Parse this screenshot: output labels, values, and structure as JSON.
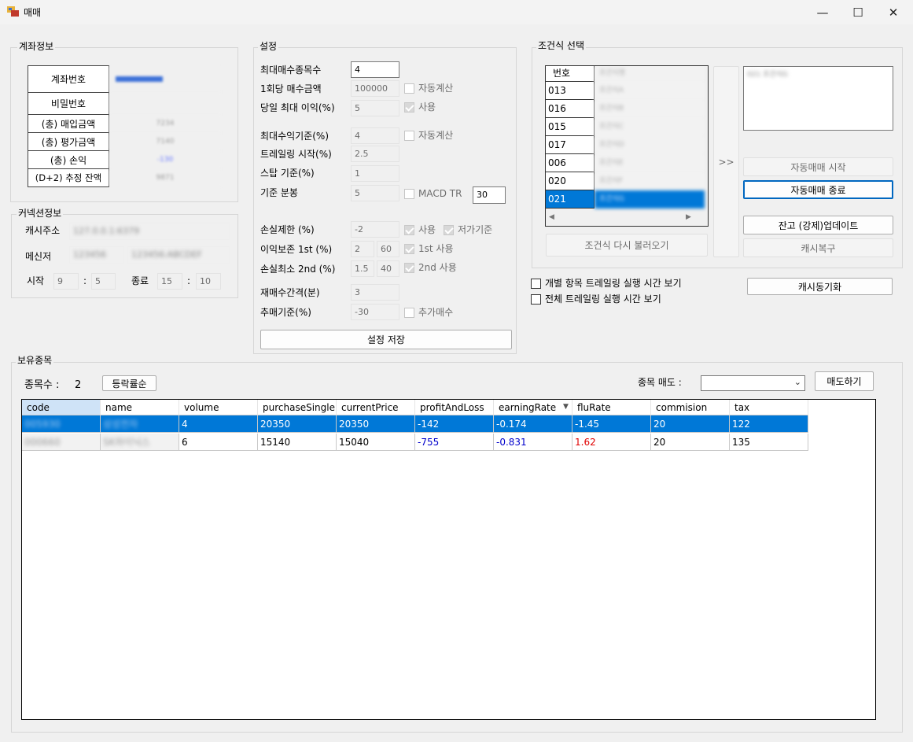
{
  "window": {
    "title": "매매",
    "minimize": "—",
    "maximize": "☐",
    "close": "✕"
  },
  "account": {
    "title": "계좌정보",
    "rows": [
      {
        "label": "계좌번호",
        "value": "■■■■■■"
      },
      {
        "label": "비밀번호",
        "value": ""
      },
      {
        "label": "(총) 매입금액",
        "value": "7234"
      },
      {
        "label": "(총) 평가금액",
        "value": "7140"
      },
      {
        "label": "(총) 손익",
        "value": "-130"
      },
      {
        "label": "(D+2) 추정 잔액",
        "value": "9871"
      }
    ]
  },
  "connection": {
    "title": "커넥션정보",
    "cache_label": "캐시주소",
    "cache_value": "127.0.0.1:6379",
    "messenger_label": "메신저",
    "messenger_value1": "123456 ",
    "messenger_value2": "123456:ABCDEF",
    "start_label": "시작",
    "start_h": "9",
    "start_m": "5",
    "sep": ":",
    "end_label": "종료",
    "end_h": "15",
    "end_m": "10"
  },
  "settings": {
    "title": "설정",
    "max_buy_count_label": "최대매수종목수",
    "max_buy_count": "4",
    "buy_amount_label": "1회당 매수금액",
    "buy_amount": "100000",
    "auto_calc1": "자동계산",
    "daily_max_profit_label": "당일 최대 이익(%)",
    "daily_max_profit": "5",
    "use1": "사용",
    "max_profit_label": "최대수익기준(%)",
    "max_profit": "4",
    "auto_calc2": "자동계산",
    "trailing_start_label": "트레일링 시작(%)",
    "trailing_start": "2.5",
    "stop_label": "스탑 기준(%)",
    "stop": "1",
    "base_minute_label": "기준 분봉",
    "base_minute": "5",
    "macd_label": "MACD TR",
    "macd_value": "30",
    "loss_limit_label": "손실제한 (%)",
    "loss_limit": "-2",
    "use2": "사용",
    "low_base": "저가기준",
    "profit_keep_label": "이익보존 1st (%)",
    "profit_keep_a": "2",
    "profit_keep_b": "60",
    "first_use": "1st 사용",
    "loss_min_label": "손실최소 2nd (%)",
    "loss_min_a": "1.5",
    "loss_min_b": "40",
    "second_use": "2nd 사용",
    "rebuy_interval_label": "재매수간격(분)",
    "rebuy_interval": "3",
    "add_buy_label": "추매기준(%)",
    "add_buy": "-30",
    "add_buy_check": "추가매수",
    "save_button": "설정 저장"
  },
  "condition": {
    "title": "조건식 선택",
    "header": "번호",
    "rows": [
      {
        "no": "013",
        "name": "조건식A"
      },
      {
        "no": "016",
        "name": "조건식B"
      },
      {
        "no": "015",
        "name": "조건식C"
      },
      {
        "no": "017",
        "name": "조건식D"
      },
      {
        "no": "006",
        "name": "조건식E"
      },
      {
        "no": "020",
        "name": "조건식F"
      },
      {
        "no": "021",
        "name": "조건식G"
      }
    ],
    "header_name": "조건식명",
    "reload_button": "조건식 다시 불러오기",
    "move_button": ">>",
    "selected_text": "021 조건식G",
    "auto_start": "자동매매 시작",
    "auto_stop": "자동매매 종료",
    "balance_update": "잔고 (강제)업데이트",
    "cache_restore": "캐시복구",
    "cache_sync": "캐시동기화",
    "view_each": "개별 항목 트레일링 실행 시간 보기",
    "view_all": "전체 트레일링 실행 시간 보기"
  },
  "holdings": {
    "title": "보유종목",
    "count_label": "종목수 :",
    "count": "2",
    "sort_button": "등락률순",
    "sell_label": "종목 매도 :",
    "sell_button": "매도하기",
    "columns": [
      "code",
      "name",
      "volume",
      "purchaseSingle",
      "currentPrice",
      "profitAndLoss",
      "earningRate",
      "fluRate",
      "commision",
      "tax"
    ],
    "rows": [
      {
        "code": "005930",
        "name": "삼성전자",
        "volume": "4",
        "purchaseSingle": "20350",
        "currentPrice": "20350",
        "profitAndLoss": "-142",
        "earningRate": "-0.174",
        "fluRate": "-1.45",
        "commision": "20",
        "tax": "122"
      },
      {
        "code": "000660",
        "name": "SK하이닉스",
        "volume": "6",
        "purchaseSingle": "15140",
        "currentPrice": "15040",
        "profitAndLoss": "-755",
        "earningRate": "-0.831",
        "fluRate": "1.62",
        "commision": "20",
        "tax": "135"
      }
    ]
  },
  "colors": {
    "selection": "#0078d7",
    "negative": "#0000cc",
    "positive": "#e00000",
    "focus": "#0067c0"
  }
}
